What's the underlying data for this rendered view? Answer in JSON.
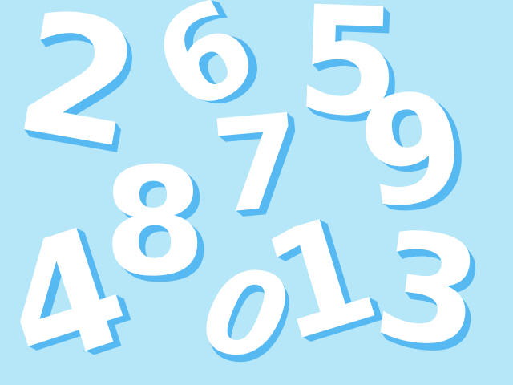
{
  "digits": {
    "two": "2",
    "six": "6",
    "five": "5",
    "seven": "7",
    "nine": "9",
    "eight": "8",
    "four": "4",
    "zero": "0",
    "one": "1",
    "three": "3"
  },
  "colors": {
    "background": "#b6e7f8",
    "digit_fill": "#ffffff",
    "digit_shadow": "#57b9f2"
  }
}
